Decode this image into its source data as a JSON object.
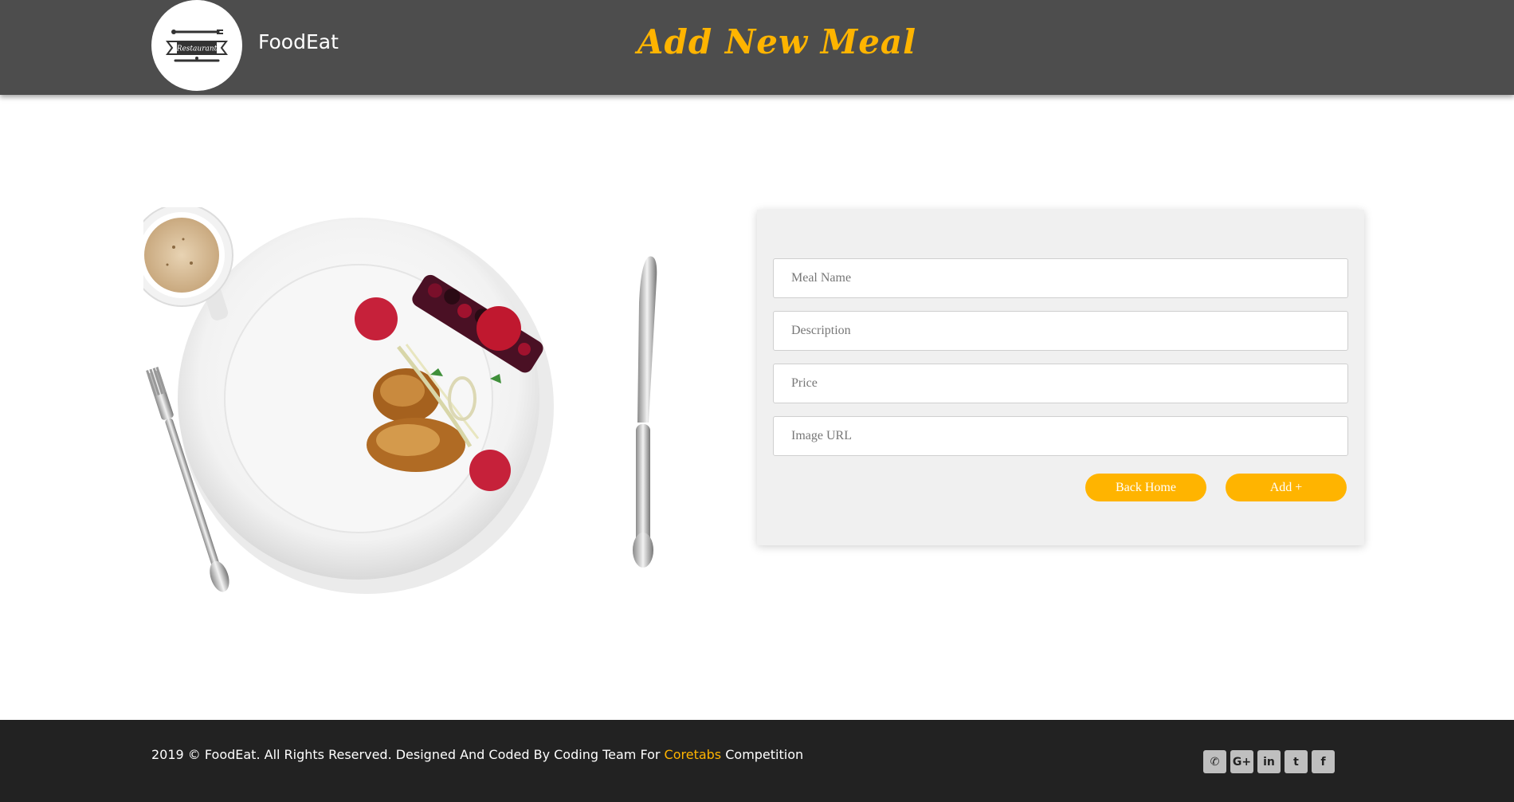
{
  "header": {
    "brand": "FoodEat",
    "title": "Add New Meal",
    "logo_text": "Restaurant"
  },
  "form": {
    "meal_name_placeholder": "Meal Name",
    "description_placeholder": "Description",
    "price_placeholder": "Price",
    "image_url_placeholder": "Image URL",
    "back_label": "Back Home",
    "add_label": "Add +"
  },
  "footer": {
    "text_before": "2019 © FoodEat. All Rights Reserved. Designed And Coded By Coding Team For ",
    "link_text": "Coretabs",
    "text_after": " Competition",
    "social": [
      {
        "icon": "phone-icon",
        "glyph": "✆"
      },
      {
        "icon": "google-plus-icon",
        "glyph": "G+"
      },
      {
        "icon": "linkedin-icon",
        "glyph": "in"
      },
      {
        "icon": "twitter-icon",
        "glyph": "t"
      },
      {
        "icon": "facebook-icon",
        "glyph": "f"
      }
    ]
  },
  "colors": {
    "accent": "#ffb400",
    "header_bg": "#4d4d4d",
    "footer_bg": "#222222",
    "card_bg": "#f0f0f0"
  }
}
